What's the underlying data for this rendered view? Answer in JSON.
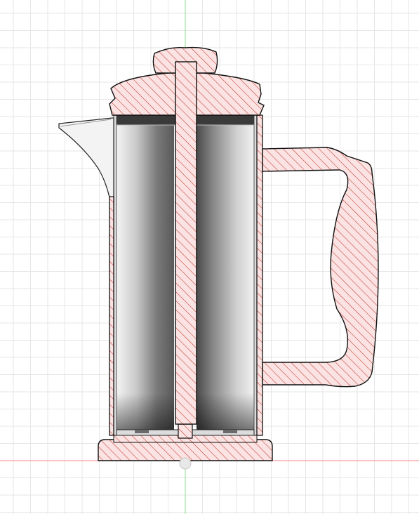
{
  "viewport": {
    "background": "#ffffff",
    "grid_visible": true,
    "grid_color": "#e6e6e6",
    "x_axis_color": "#f08a8a",
    "y_axis_color": "#8ee08e"
  },
  "model": {
    "type": "french-press-section-view",
    "hatch_fill": "#fbe3e3",
    "hatch_line": "#c0392b",
    "outline": "#111111",
    "glass_shade": "#bdbdbd",
    "parts": [
      "lid-knob",
      "lid",
      "plunger-rod",
      "glass-beaker",
      "spout",
      "handle",
      "frame",
      "base",
      "filter-screen"
    ]
  }
}
